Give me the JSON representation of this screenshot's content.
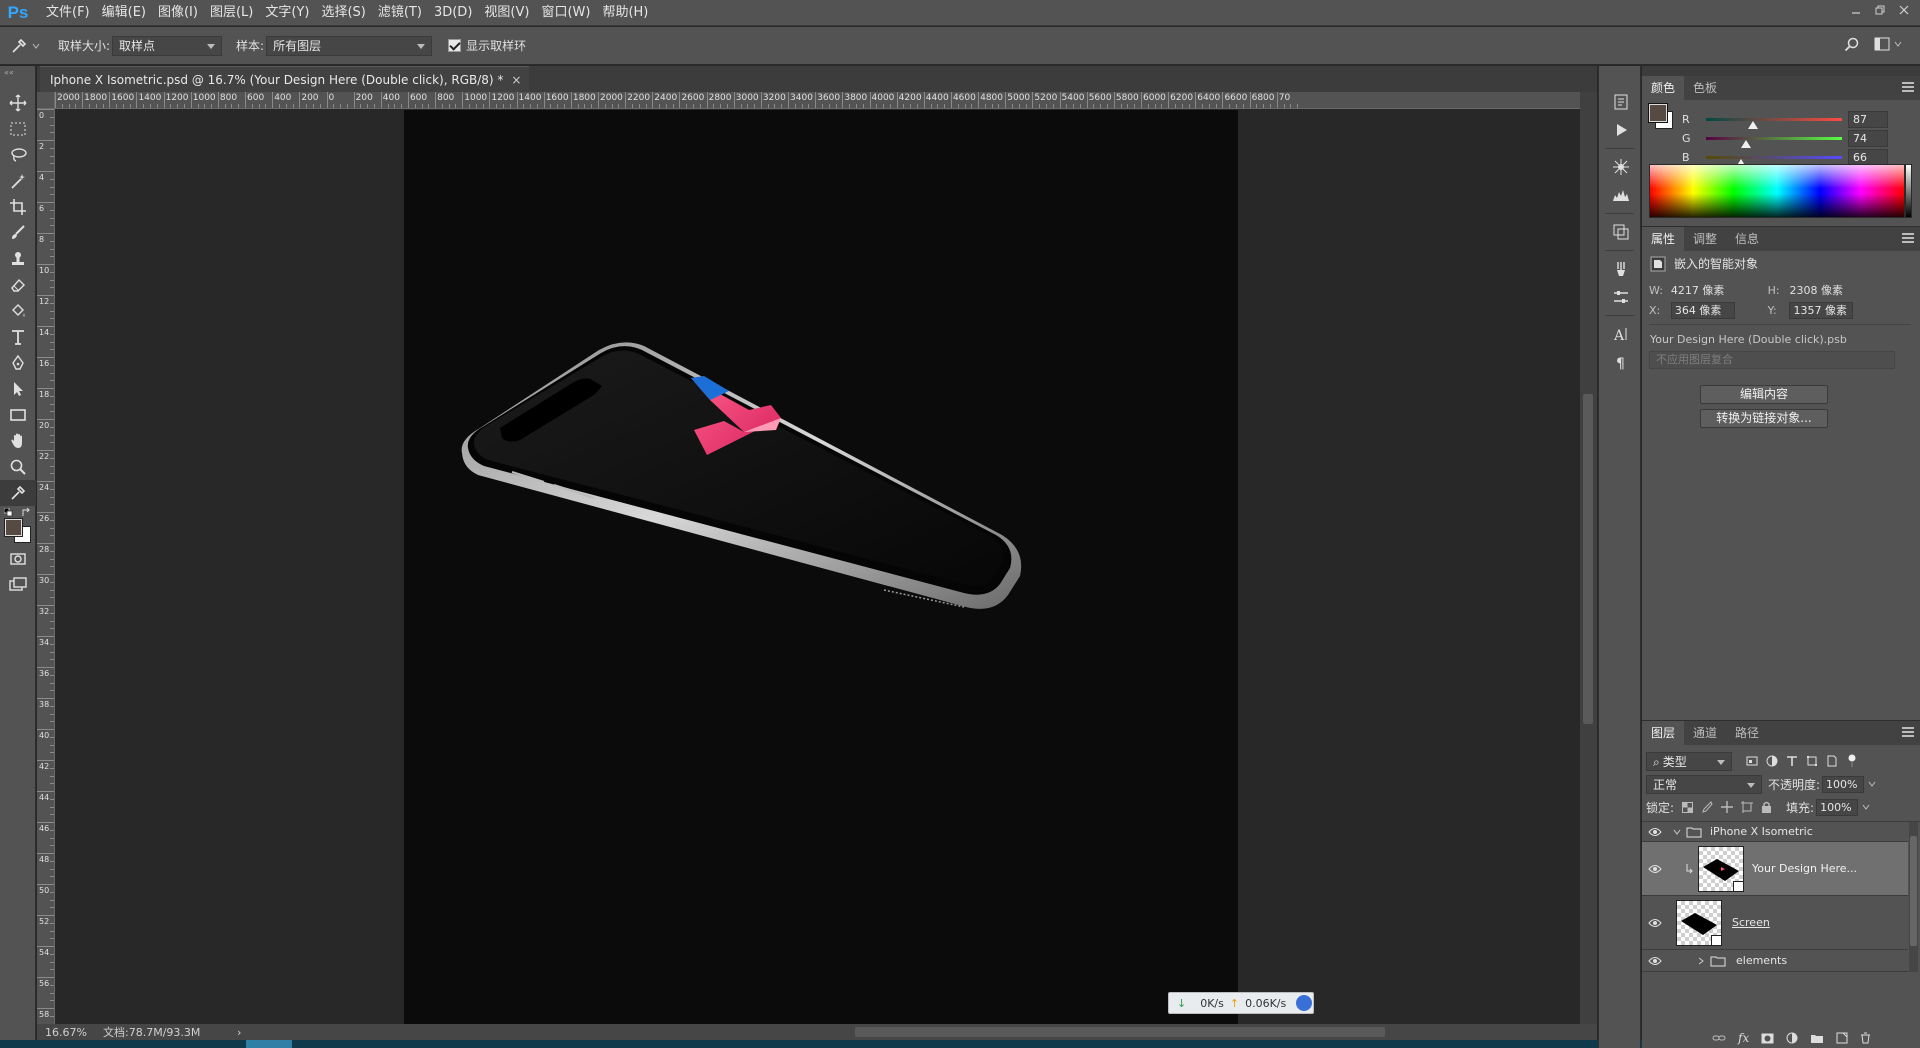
{
  "app": {
    "logo": "Ps"
  },
  "menu": [
    "文件(F)",
    "编辑(E)",
    "图像(I)",
    "图层(L)",
    "文字(Y)",
    "选择(S)",
    "滤镜(T)",
    "3D(D)",
    "视图(V)",
    "窗口(W)",
    "帮助(H)"
  ],
  "window_controls": [
    "minimize",
    "restore",
    "close"
  ],
  "options": {
    "sample_size_label": "取样大小:",
    "sample_size_value": "取样点",
    "sample_label": "样本:",
    "sample_value": "所有图层",
    "show_ring_label": "显示取样环",
    "show_ring_checked": true
  },
  "document": {
    "tab_title": "Iphone X Isometric.psd @ 16.7% (Your Design Here (Double click), RGB/8) *",
    "close": "×",
    "ruler_h_ticks": [
      "2000",
      "1800",
      "1600",
      "1400",
      "1200",
      "1000",
      "800",
      "600",
      "400",
      "200",
      "0",
      "200",
      "400",
      "600",
      "800",
      "1000",
      "1200",
      "1400",
      "1600",
      "1800",
      "2000",
      "2200",
      "2400",
      "2600",
      "2800",
      "3000",
      "3200",
      "3400",
      "3600",
      "3800",
      "4000",
      "4200",
      "4400",
      "4600",
      "4800",
      "5000",
      "5200",
      "5400",
      "5600",
      "5800",
      "6000",
      "6200",
      "6400",
      "6600",
      "6800",
      "70"
    ],
    "ruler_v_ticks": [
      "0",
      "2",
      "4",
      "6",
      "8",
      "10",
      "12",
      "14",
      "16",
      "18",
      "20",
      "22",
      "24",
      "26",
      "28",
      "30",
      "32",
      "34",
      "36",
      "38",
      "40",
      "42",
      "44",
      "46",
      "48",
      "50",
      "52",
      "54",
      "56",
      "58"
    ],
    "canvas_logo_glyph": "4"
  },
  "status": {
    "zoom": "16.67%",
    "doc_size": "文档:78.7M/93.3M",
    "arrow": "›"
  },
  "network": {
    "down": "0K/s",
    "up": "0.06K/s"
  },
  "color_panel": {
    "tabs": [
      "颜色",
      "色板"
    ],
    "foreground": "#574a42",
    "background": "#ffffff",
    "channels": [
      {
        "label": "R",
        "value": "87",
        "level": 87
      },
      {
        "label": "G",
        "value": "74",
        "level": 74
      },
      {
        "label": "B",
        "value": "66",
        "level": 66
      }
    ]
  },
  "properties_panel": {
    "tabs": [
      "属性",
      "调整",
      "信息"
    ],
    "object_type": "嵌入的智能对象",
    "w_label": "W:",
    "w_value": "4217 像素",
    "h_label": "H:",
    "h_value": "2308 像素",
    "x_label": "X:",
    "x_value": "364 像素",
    "y_label": "Y:",
    "y_value": "1357 像素",
    "file_name": "Your Design Here (Double click).psb",
    "comp_placeholder": "不应用图层复合",
    "edit_button": "编辑内容",
    "convert_button": "转换为链接对象..."
  },
  "layers_panel": {
    "tabs": [
      "图层",
      "通道",
      "路径"
    ],
    "filter_value": "类型",
    "blend_mode": "正常",
    "opacity_label": "不透明度:",
    "opacity_value": "100%",
    "lock_label": "锁定:",
    "fill_label": "填充:",
    "fill_value": "100%",
    "layers": [
      {
        "name": "iPhone X Isometric",
        "kind": "group",
        "expanded": true
      },
      {
        "name": "Your Design Here...",
        "kind": "smart-object",
        "selected": true
      },
      {
        "name": "Screen",
        "kind": "smart-object"
      },
      {
        "name": "elements",
        "kind": "group",
        "expanded": false
      }
    ],
    "footer_fx": "fx"
  }
}
